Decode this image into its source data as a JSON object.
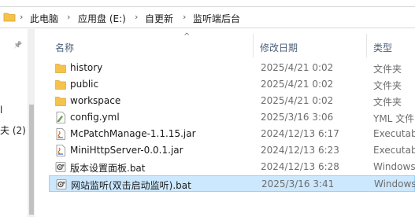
{
  "breadcrumb": [
    {
      "label": "此电脑"
    },
    {
      "label": "应用盘 (E:)"
    },
    {
      "label": "自更新"
    },
    {
      "label": "监听端后台"
    }
  ],
  "breadcrumb_separator": "›",
  "nav": {
    "pin_glyph": "📌",
    "fragment_1": "l",
    "fragment_2": "夫 (2)"
  },
  "columns": {
    "name": "名称",
    "date": "修改日期",
    "type": "类型"
  },
  "files": [
    {
      "name": "history",
      "date": "2025/4/21 0:02",
      "type": "文件夹",
      "icon": "folder-icon"
    },
    {
      "name": "public",
      "date": "2025/4/21 0:02",
      "type": "文件夹",
      "icon": "folder-icon"
    },
    {
      "name": "workspace",
      "date": "2025/4/21 0:02",
      "type": "文件夹",
      "icon": "folder-icon"
    },
    {
      "name": "config.yml",
      "date": "2025/3/16 3:06",
      "type": "YML 文件",
      "icon": "yml-file-icon"
    },
    {
      "name": "McPatchManage-1.1.15.jar",
      "date": "2024/12/13 6:17",
      "type": "Executab",
      "icon": "jar-file-icon"
    },
    {
      "name": "MiniHttpServer-0.0.1.jar",
      "date": "2024/12/13 6:23",
      "type": "Executab",
      "icon": "jar-file-icon"
    },
    {
      "name": "版本设置面板.bat",
      "date": "2024/12/13 6:28",
      "type": "Windows",
      "icon": "bat-file-icon"
    },
    {
      "name": "网站监听(双击启动监听).bat",
      "date": "2025/3/16 3:41",
      "type": "Windows",
      "icon": "bat-file-icon",
      "selected": true
    }
  ],
  "colors": {
    "selection_bg": "#cce8ff",
    "selection_border": "#99d1ff",
    "folder": "#f5c24c",
    "header_text": "#4c607a"
  }
}
